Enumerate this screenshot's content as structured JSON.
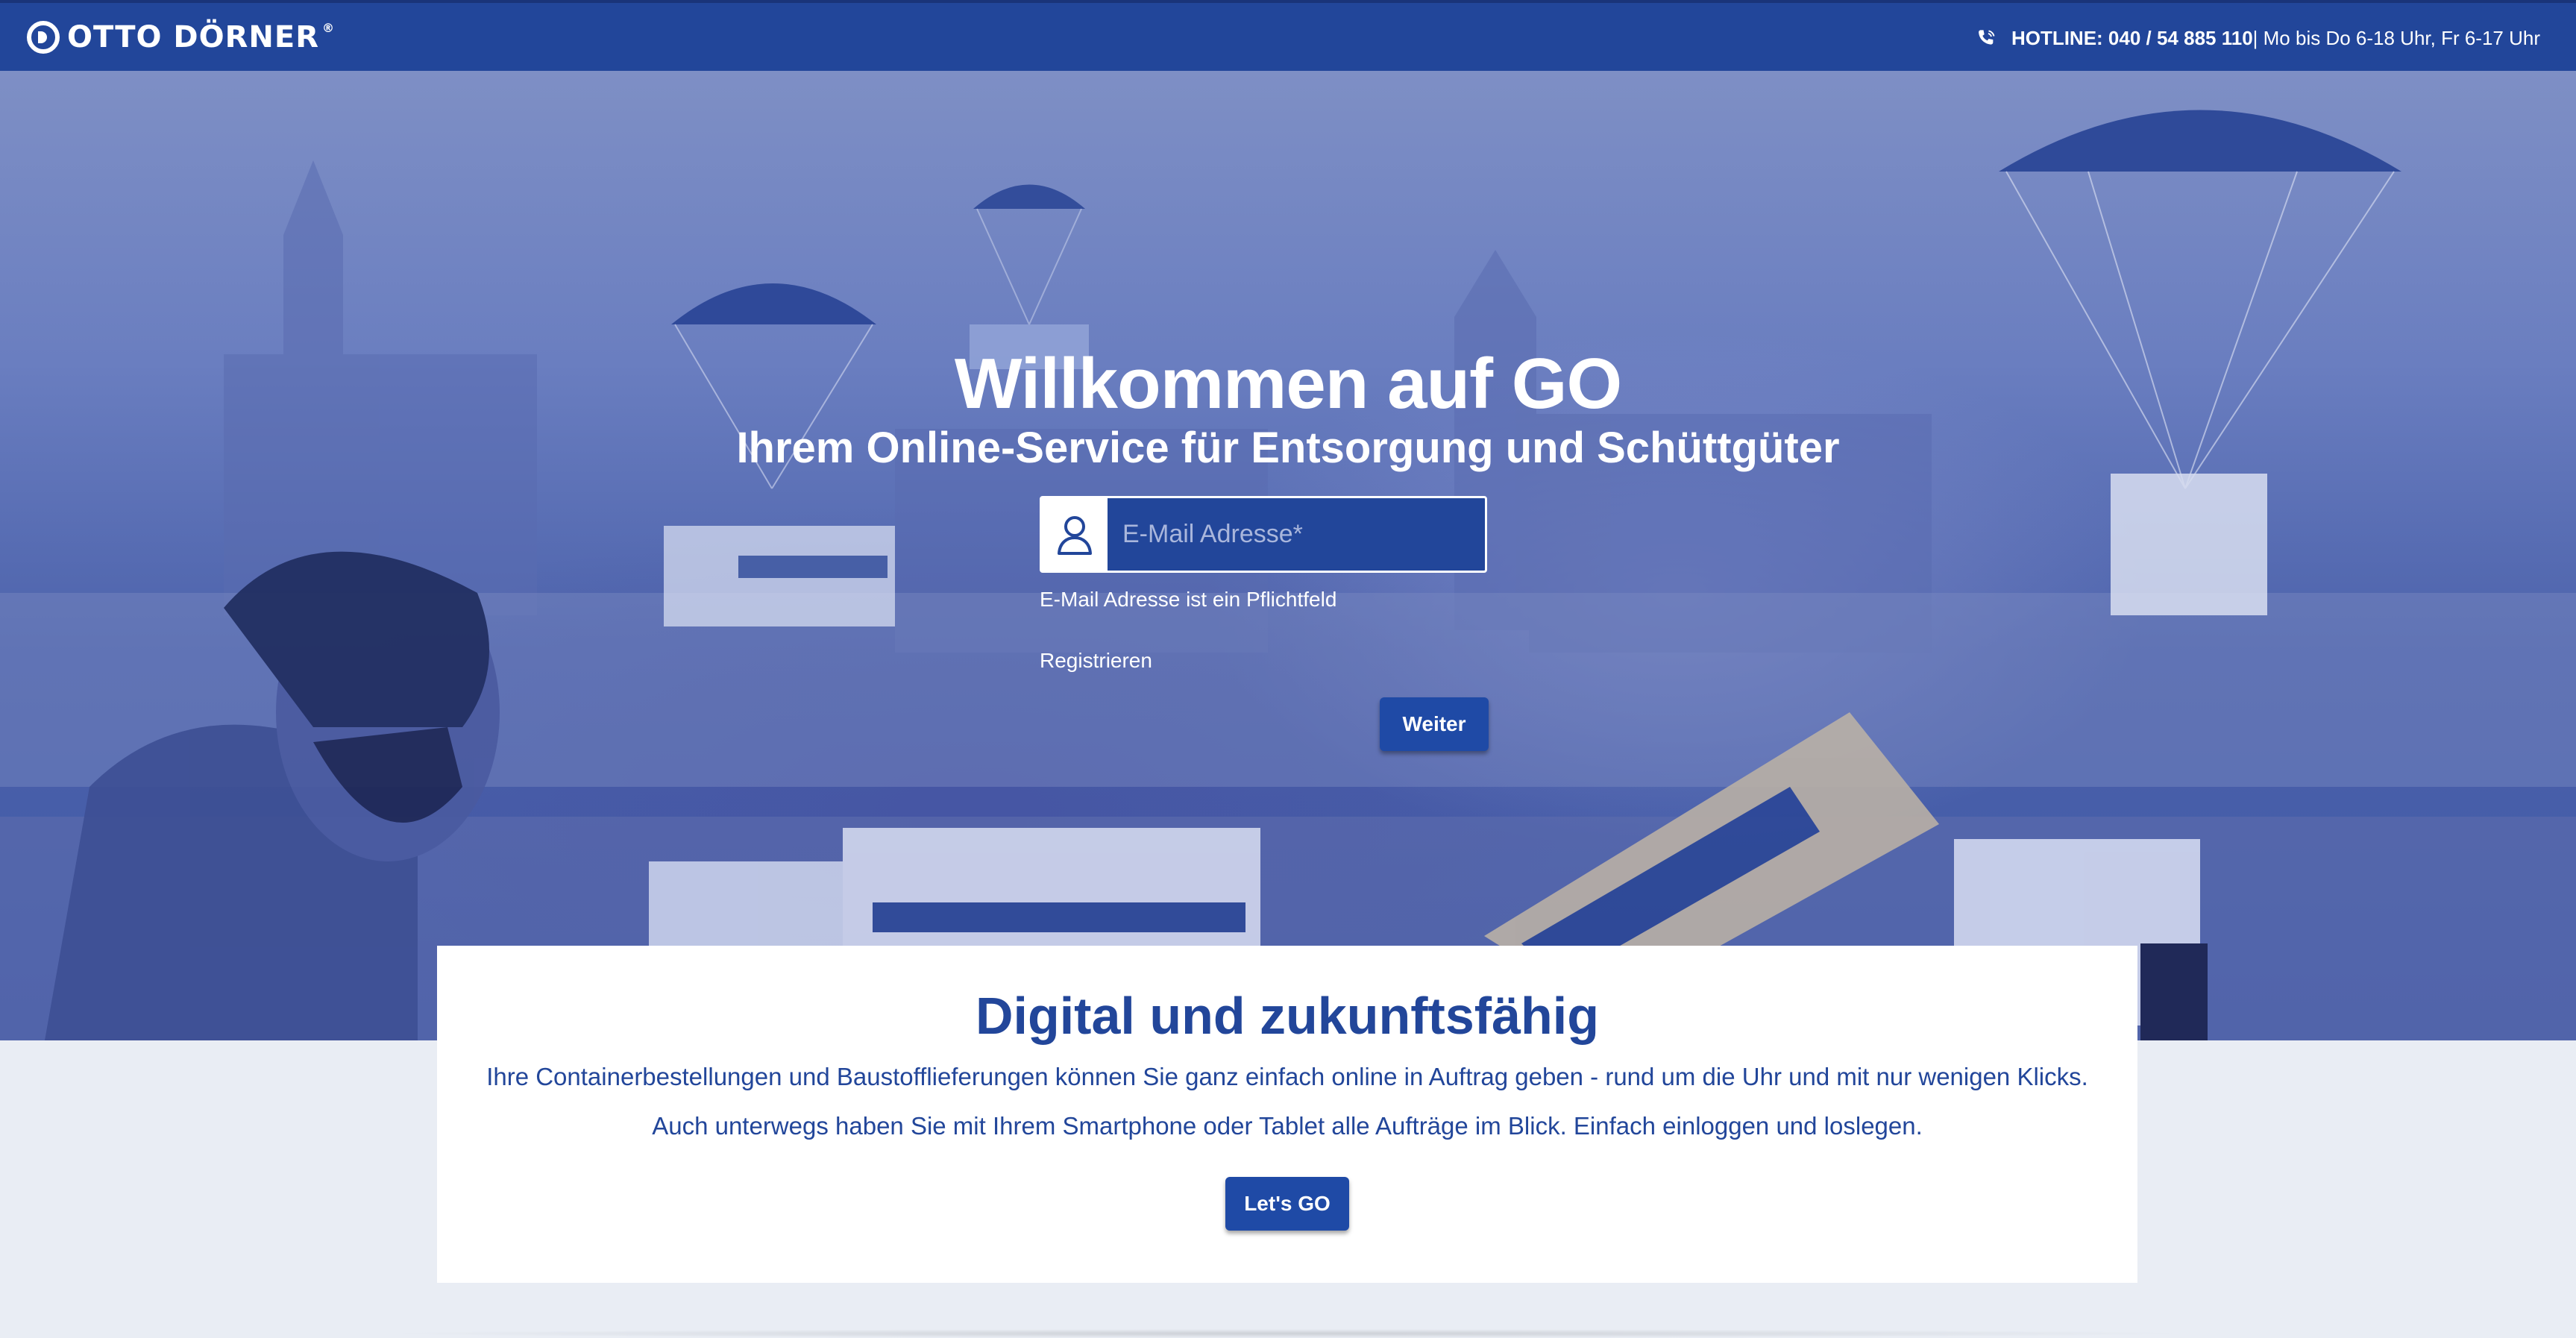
{
  "header": {
    "logo_text": "OTTO DÖRNER",
    "logo_reg": "®",
    "hotline_label": "HOTLINE: 040 / 54 885 110",
    "hotline_hours": " | Mo bis Do 6-18 Uhr, Fr 6-17 Uhr",
    "icons": {
      "logo": "otto-doerner-logo-icon",
      "phone": "phone-icon"
    }
  },
  "hero": {
    "title": "Willkommen auf GO",
    "subtitle": "Ihrem Online-Service für Entsorgung und Schüttgüter",
    "email_placeholder": "E-Mail Adresse*",
    "email_value": "",
    "email_icon": "user-icon",
    "email_hint": "E-Mail Adresse ist ein Pflichtfeld",
    "register_label": "Registrieren",
    "submit_label": "Weiter"
  },
  "card": {
    "title": "Digital und zukunftsfähig",
    "text_1": "Ihre Containerbestellungen und Baustofflieferungen können Sie ganz einfach online in Auftrag geben - rund um die Uhr und mit nur wenigen Klicks.",
    "text_2": "Auch unterwegs haben Sie mit Ihrem Smartphone oder Tablet alle Aufträge im Blick. Einfach einloggen und loslegen.",
    "button_label": "Let's GO"
  },
  "colors": {
    "brand_blue": "#22469a",
    "button_blue": "#1f4aa6",
    "page_background": "#e9edf4",
    "card_background": "#ffffff"
  }
}
